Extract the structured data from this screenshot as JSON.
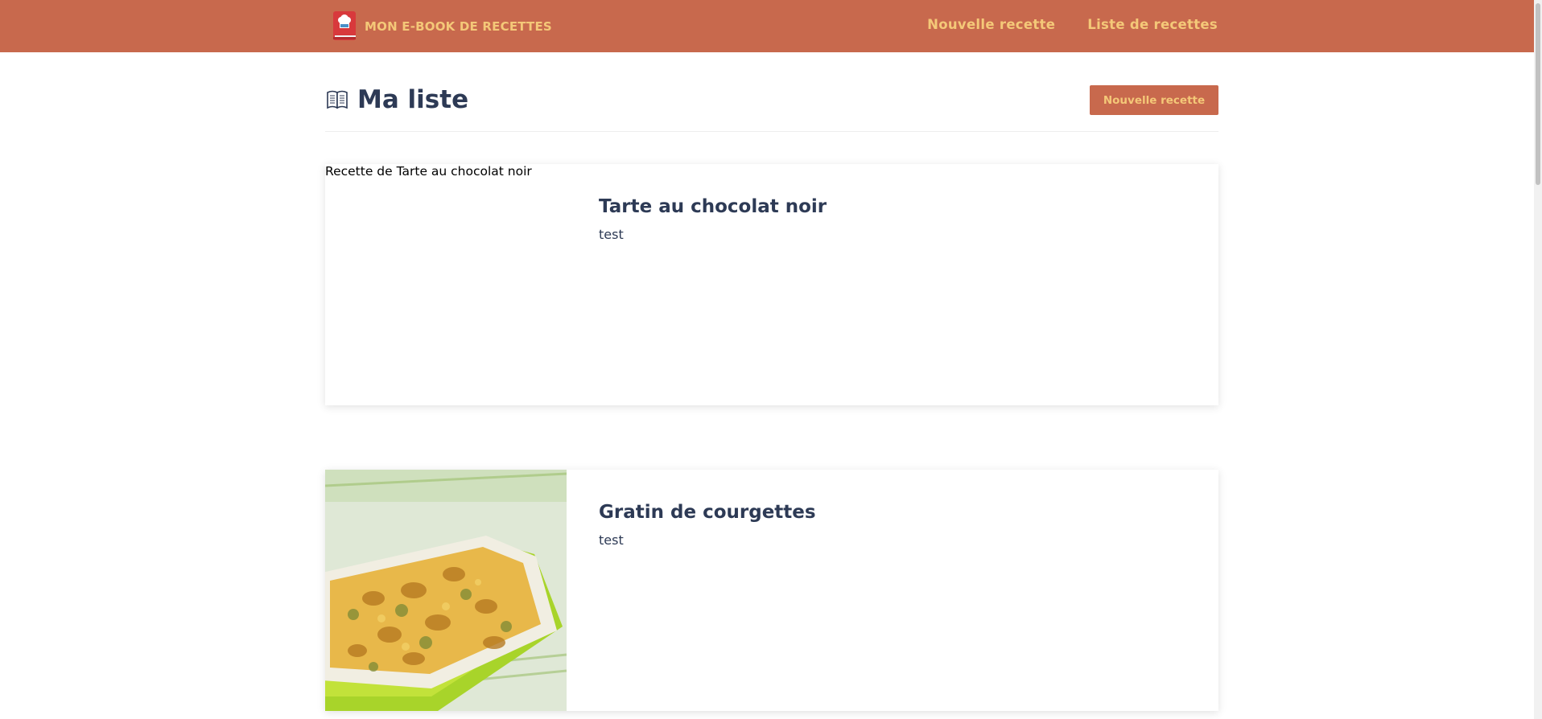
{
  "nav": {
    "brand": "MON E-BOOK DE RECETTES",
    "links": [
      "Nouvelle recette",
      "Liste de recettes"
    ]
  },
  "header": {
    "title": "Ma liste",
    "button_label": "Nouvelle recette"
  },
  "recipes": [
    {
      "title": "Tarte au chocolat noir",
      "description": "test",
      "image_alt": "Recette de Tarte au chocolat noir",
      "image_loaded": false
    },
    {
      "title": "Gratin de courgettes",
      "description": "test",
      "image_alt": "",
      "image_loaded": true
    }
  ],
  "colors": {
    "nav_bg": "#c8694d",
    "nav_text": "#f4c878",
    "title": "#2d3a55"
  }
}
